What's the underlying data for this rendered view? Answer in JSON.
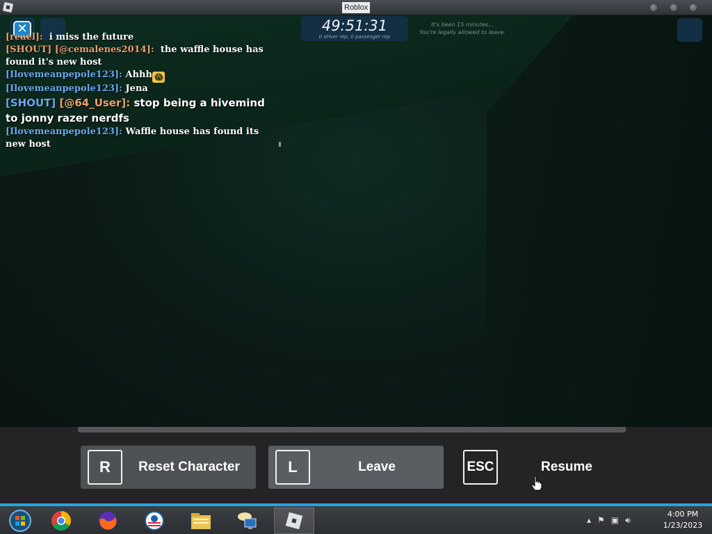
{
  "window": {
    "title": "Roblox"
  },
  "hud": {
    "close_glyph": "✕",
    "timer": "49:51:31",
    "timer_sub": "0 driver rep, 0 passenger rep",
    "notice_line1": "It's been 15 minutes...",
    "notice_line2": "You're legally allowed to leave."
  },
  "chat": {
    "messages": [
      {
        "tag": "",
        "user": "[reael]:",
        "user_color": "orange",
        "text": "i miss the future"
      },
      {
        "tag": "[SHOUT]",
        "user": "[@cemalenes2014]:",
        "user_color": "orange",
        "text": "the waffle house has found it's new host"
      },
      {
        "tag": "",
        "user": "[Ilovemeanpepole123]:",
        "user_color": "blue",
        "text": "Ahhh",
        "emoji": "😱"
      },
      {
        "tag": "",
        "user": "[Ilovemeanpepole123]:",
        "user_color": "blue",
        "text": "Jena"
      },
      {
        "tag": "[SHOUT]",
        "user": "[@64_User]:",
        "user_color": "orange",
        "text": "stop being a hivemind to jonny razer nerdfs"
      },
      {
        "tag": "",
        "user": "[Ilovemeanpepole123]:",
        "user_color": "blue",
        "text": "Waffle house has found its new host"
      }
    ]
  },
  "menu": {
    "reset": {
      "key": "R",
      "label": "Reset Character"
    },
    "leave": {
      "key": "L",
      "label": "Leave"
    },
    "resume": {
      "key": "ESC",
      "label": "Resume"
    }
  },
  "taskbar": {
    "apps": [
      {
        "name": "windows-start-icon"
      },
      {
        "name": "chrome-icon"
      },
      {
        "name": "firefox-icon"
      },
      {
        "name": "obama-logo-icon"
      },
      {
        "name": "file-explorer-icon"
      },
      {
        "name": "remote-desktop-icon"
      },
      {
        "name": "roblox-icon",
        "active": true
      }
    ],
    "time": "4:00 PM",
    "date": "1/23/2023"
  },
  "colors": {
    "accent": "#1fa8e0",
    "chat_orange": "#e9a06a",
    "chat_blue": "#6aa8ea",
    "menu_bg": "#242426",
    "button_bg": "#4e5255"
  }
}
